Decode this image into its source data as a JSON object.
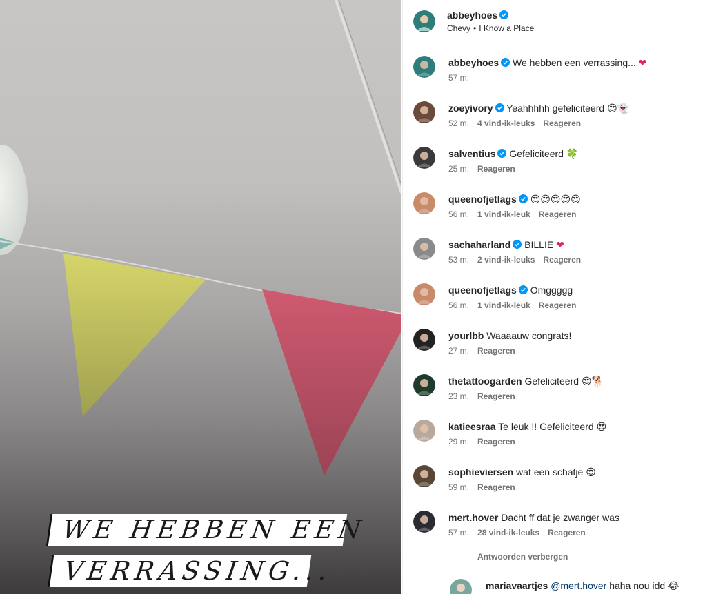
{
  "media": {
    "caption_line1": "WE HEBBEN EEN",
    "caption_line2": "VERRASSING..."
  },
  "header": {
    "username": "abbeyhoes",
    "verified": true,
    "music_artist": "Chevy",
    "separator": "•",
    "music_track": "I Know a Place"
  },
  "comments": [
    {
      "username": "abbeyhoes",
      "verified": true,
      "text": "We hebben een verrassing...",
      "emoji": "❤",
      "time": "57 m.",
      "likes": "",
      "reply": "",
      "avatar_color": "#2e7d7a"
    },
    {
      "username": "zoeyivory",
      "verified": true,
      "text": "Yeahhhhh gefeliciteerd",
      "emoji": "😍👻",
      "time": "52 m.",
      "likes": "4 vind-ik-leuks",
      "reply": "Reageren",
      "avatar_color": "#6b4a3a"
    },
    {
      "username": "salventius",
      "verified": true,
      "text": "Gefeliciteerd",
      "emoji": "🍀",
      "time": "25 m.",
      "likes": "",
      "reply": "Reageren",
      "avatar_color": "#3a3a3a"
    },
    {
      "username": "queenofjetlags",
      "verified": true,
      "text": "",
      "emoji": "😍😍😍😍😍",
      "time": "56 m.",
      "likes": "1 vind-ik-leuk",
      "reply": "Reageren",
      "avatar_color": "#c98a6a"
    },
    {
      "username": "sachaharland",
      "verified": true,
      "text": "BILLIE",
      "emoji": "❤",
      "time": "53 m.",
      "likes": "2 vind-ik-leuks",
      "reply": "Reageren",
      "avatar_color": "#8a8a8a"
    },
    {
      "username": "queenofjetlags",
      "verified": true,
      "text": "Omggggg",
      "emoji": "",
      "time": "56 m.",
      "likes": "1 vind-ik-leuk",
      "reply": "Reageren",
      "avatar_color": "#c98a6a"
    },
    {
      "username": "yourlbb",
      "verified": false,
      "text": "Waaaauw congrats!",
      "emoji": "",
      "time": "27 m.",
      "likes": "",
      "reply": "Reageren",
      "avatar_color": "#222222"
    },
    {
      "username": "thetattoogarden",
      "verified": false,
      "text": "Gefeliciteerd",
      "emoji": "😍🐕",
      "time": "23 m.",
      "likes": "",
      "reply": "Reageren",
      "avatar_color": "#1f3b2c"
    },
    {
      "username": "katieesraa",
      "verified": false,
      "text": "Te leuk !! Gefeliciteerd",
      "emoji": "😍",
      "time": "29 m.",
      "likes": "",
      "reply": "Reageren",
      "avatar_color": "#b8a99e"
    },
    {
      "username": "sophieviersen",
      "verified": false,
      "text": "wat een schatje",
      "emoji": "😍",
      "time": "59 m.",
      "likes": "",
      "reply": "Reageren",
      "avatar_color": "#5a4636"
    },
    {
      "username": "mert.hover",
      "verified": false,
      "text": "Dacht ff dat je zwanger was",
      "emoji": "",
      "time": "57 m.",
      "likes": "28 vind-ik-leuks",
      "reply": "Reageren",
      "avatar_color": "#2b2b33"
    }
  ],
  "toggle_replies_label": "Antwoorden verbergen",
  "reply": {
    "username": "mariavaartjes",
    "mention": "@mert.hover",
    "text": "haha nou idd",
    "emoji": "😂",
    "avatar_color": "#7aa6a0"
  },
  "colors": {
    "verified_blue": "#0095f6",
    "heart_red": "#e0245e",
    "flag_yellow": "#d9d86b",
    "flag_pink": "#d2546f"
  }
}
